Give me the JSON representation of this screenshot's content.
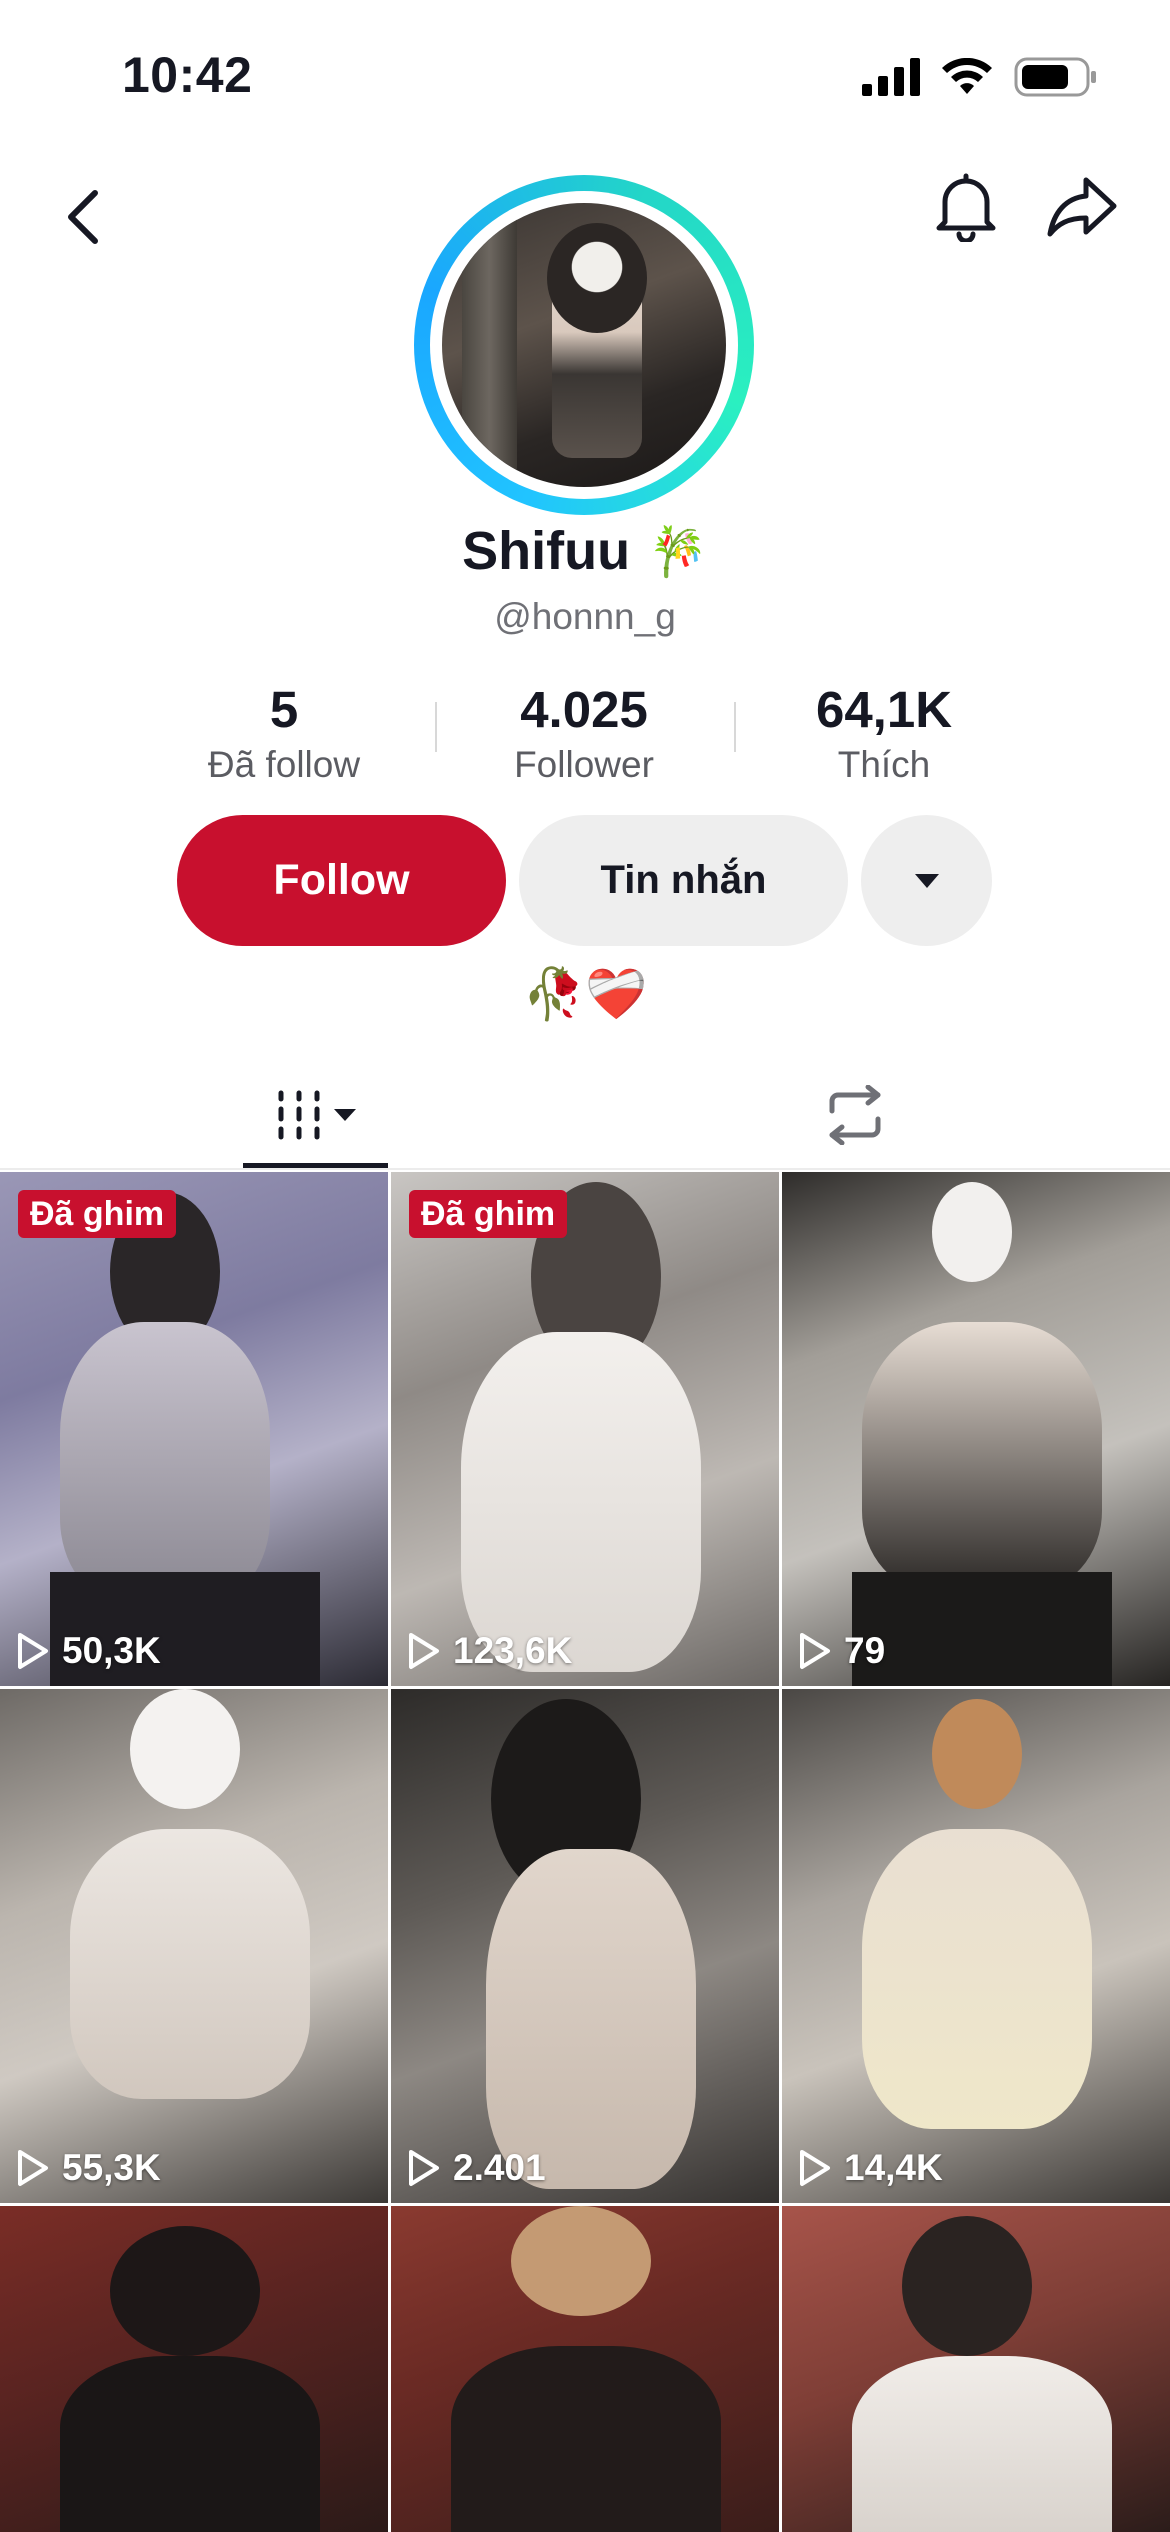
{
  "status_bar": {
    "time": "10:42"
  },
  "profile": {
    "display_name": "Shifuu",
    "name_emoji": "🎋",
    "username": "@honnn_g",
    "bio": "🥀❤️‍🩹"
  },
  "stats": [
    {
      "value": "5",
      "label": "Đã follow"
    },
    {
      "value": "4.025",
      "label": "Follower"
    },
    {
      "value": "64,1K",
      "label": "Thích"
    }
  ],
  "actions": {
    "follow": "Follow",
    "message": "Tin nhắn"
  },
  "pinned_label": "Đã ghim",
  "videos": [
    {
      "views": "50,3K",
      "pinned": true
    },
    {
      "views": "123,6K",
      "pinned": true
    },
    {
      "views": "79",
      "pinned": false
    },
    {
      "views": "55,3K",
      "pinned": false
    },
    {
      "views": "2.401",
      "pinned": false
    },
    {
      "views": "14,4K",
      "pinned": false
    },
    {
      "views": "",
      "pinned": false
    },
    {
      "views": "",
      "pinned": false
    },
    {
      "views": "",
      "pinned": false
    }
  ],
  "colors": {
    "accent": "#c8102e",
    "ring_start": "#21c4ff",
    "ring_end": "#2af0c0",
    "secondary_button": "#eeeeee"
  },
  "icons": [
    "back-icon",
    "bell-icon",
    "share-icon",
    "dropdown-caret-icon",
    "videos-grid-icon",
    "repost-icon",
    "play-icon",
    "signal-icon",
    "wifi-icon",
    "battery-icon"
  ]
}
